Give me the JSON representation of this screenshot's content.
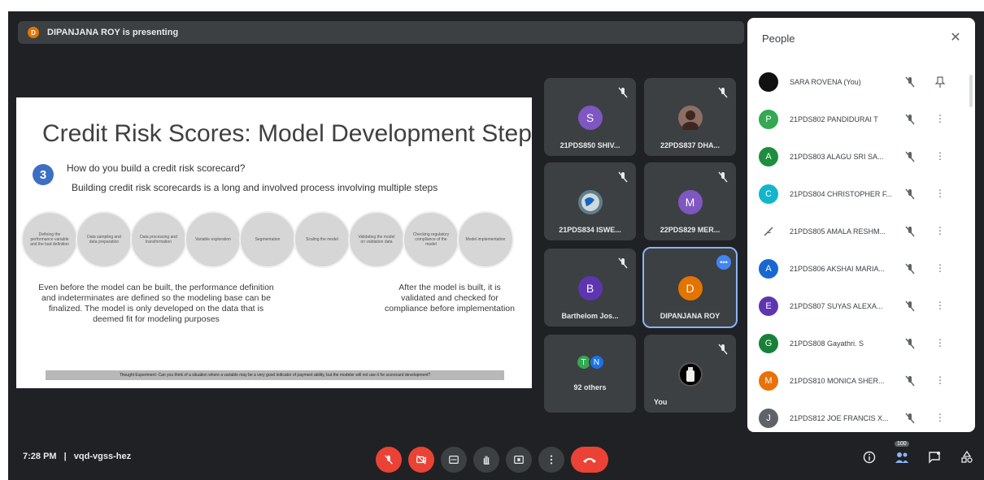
{
  "presenting": {
    "initial": "D",
    "text": "DIPANJANA ROY is presenting"
  },
  "slide": {
    "title": "Credit Risk Scores: Model Development Steps",
    "step_number": "3",
    "question": "How do you build  a credit risk scorecard?",
    "subtitle": "Building credit risk scorecards is a long and involved process involving multiple steps",
    "steps": [
      "Defining the performance variable and the bad definition",
      "Data sampling and data preparation",
      "Data processing and transformation",
      "Variable exploration",
      "Segmentation",
      "Scaling the model",
      "Validating the model on validation data",
      "Checking regulatory compliance of the model",
      "Model implementation"
    ],
    "para_left": "Even before the model can be built, the performance definition and indeterminates are defined so the modeling base can be finalized. The model is only developed on the data that is deemed fit for modeling purposes",
    "para_right": "After the model is built, it is validated and checked for compliance before implementation",
    "thought": "Thought Experiment: Can you think of a situation where a variable may be a very good indicator of payment ability, but the modeler will not use it for scorecard development?"
  },
  "tiles": [
    {
      "initial": "S",
      "name": "21PDS850 SHIV...",
      "color": "#7e57c2"
    },
    {
      "initial": "",
      "name": "22PDS837 DHA...",
      "color": "#8d6e63"
    },
    {
      "initial": "",
      "name": "21PDS834 ISWE...",
      "color": "#607d8b"
    },
    {
      "initial": "M",
      "name": "22PDS829 MER...",
      "color": "#7e57c2"
    },
    {
      "initial": "B",
      "name": "Barthelom Jos...",
      "color": "#5e35b1"
    },
    {
      "initial": "D",
      "name": "DIPANJANA ROY",
      "color": "#e37400",
      "more": "•••"
    },
    {
      "name": "92 others",
      "a1": "T",
      "a2": "N",
      "a1_color": "#34a853",
      "a2_color": "#1a73e8"
    },
    {
      "initial": "",
      "name": "You",
      "color": "#000000"
    }
  ],
  "people": {
    "title": "People",
    "close": "✕",
    "list": [
      {
        "initial": "",
        "name": "SARA ROVENA (You)",
        "color": "#111111",
        "action": "pin"
      },
      {
        "initial": "P",
        "name": "21PDS802 PANDIDURAI T",
        "color": "#34a853",
        "action": "more"
      },
      {
        "initial": "A",
        "name": "21PDS803 ALAGU SRI SA...",
        "color": "#1e8e3e",
        "action": "more"
      },
      {
        "initial": "C",
        "name": "21PDS804 CHRISTOPHER F...",
        "color": "#12b5cb",
        "action": "more"
      },
      {
        "initial": "",
        "name": "21PDS805 AMALA RESHM...",
        "color": "#ffffff",
        "action": "more"
      },
      {
        "initial": "A",
        "name": "21PDS806 AKSHAI MARIA...",
        "color": "#1967d2",
        "action": "more"
      },
      {
        "initial": "E",
        "name": "21PDS807 SUYAS ALEXA...",
        "color": "#5e35b1",
        "action": "more"
      },
      {
        "initial": "G",
        "name": "21PDS808 Gayathri. S",
        "color": "#188038",
        "action": "more"
      },
      {
        "initial": "M",
        "name": "21PDS810 MONICA SHER...",
        "color": "#e8710a",
        "action": "more"
      },
      {
        "initial": "J",
        "name": "21PDS812 JOE FRANCIS X...",
        "color": "#5f6368",
        "action": "more"
      }
    ]
  },
  "meeting": {
    "time": "7:28 PM",
    "separator": "|",
    "code": "vqd-vgss-hez"
  },
  "people_count": "100"
}
